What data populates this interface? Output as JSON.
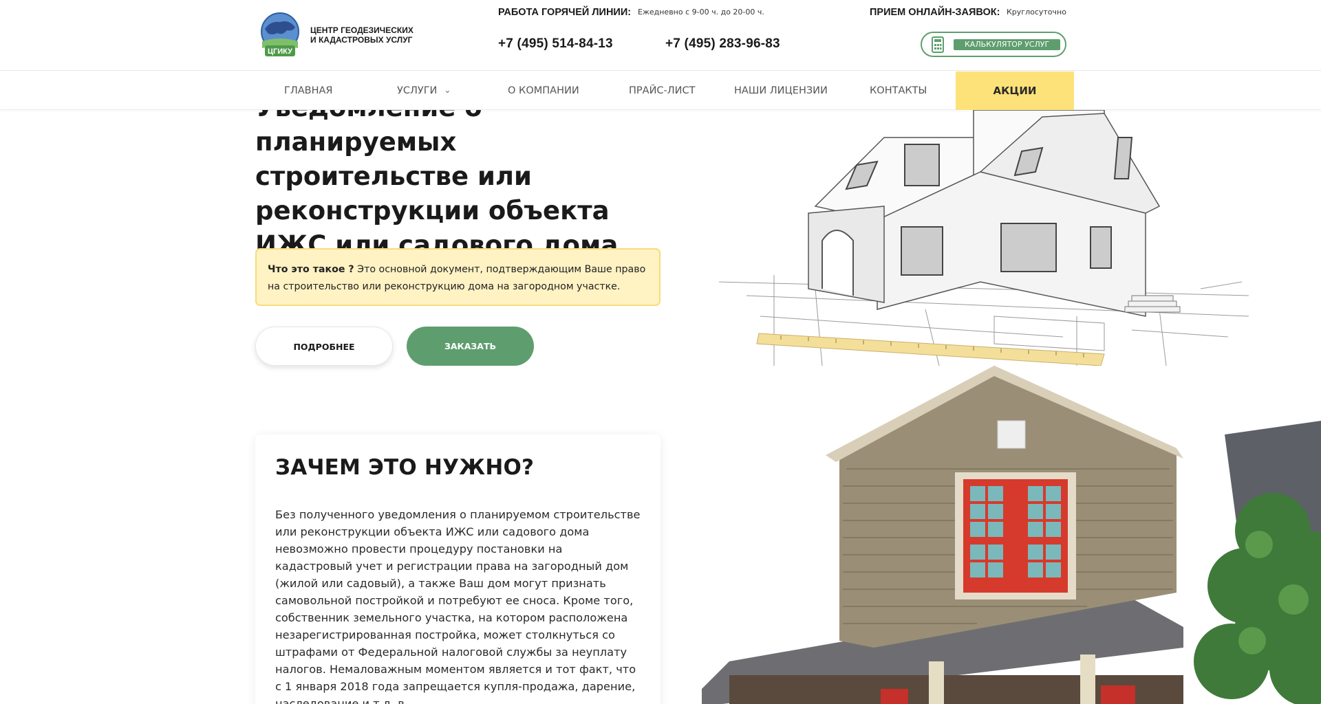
{
  "header": {
    "logo": {
      "abbr": "ЦГИКУ",
      "name": "ЦЕНТР ГЕОДЕЗИЧЕСКИХ\nИ КАДАСТРОВЫХ УСЛУГ"
    },
    "hotline": {
      "label": "РАБОТА ГОРЯЧЕЙ ЛИНИИ:",
      "hours": "Ежедневно с 9-00 ч. до 20-00 ч."
    },
    "phones": [
      "+7 (495) 514-84-13",
      "+7 (495) 283-96-83"
    ],
    "online": {
      "label": "ПРИЕМ ОНЛАЙН-ЗАЯВОК:",
      "hours": "Круглосуточно"
    },
    "calculator_label": "КАЛЬКУЛЯТОР УСЛУГ"
  },
  "nav": {
    "items": [
      "ГЛАВНАЯ",
      "УСЛУГИ",
      "О КОМПАНИИ",
      "ПРАЙС-ЛИСТ",
      "НАШИ ЛИЦЕНЗИИ",
      "КОНТАКТЫ"
    ],
    "promo": "АКЦИИ"
  },
  "hero": {
    "title": "Уведомление о планируемых строительстве или реконструкции объекта ИЖС или садового дома",
    "info_bold": "Что это такое ?",
    "info_text": " Это основной документ, подтверждающим Ваше право на строительство или реконструкцию дома на загородном участке.",
    "more_button": "ПОДРОБНЕЕ",
    "order_button": "ЗАКАЗАТЬ"
  },
  "why": {
    "title": "ЗАЧЕМ ЭТО НУЖНО?",
    "text": "Без полученного уведомления о планируемом строительстве или реконструкции объекта ИЖС или садового дома невозможно провести процедуру постановки на кадастровый учет и регистрации права на загородный дом (жилой или садовый), а также Ваш дом могут признать самовольной постройкой и потребуют ее сноса. Кроме того, собственник земельного участка, на котором расположена незарегистрированная постройка, может столкнуться со штрафами от Федеральной налоговой службы за неуплату налогов. Немаловажным моментом является и тот факт, что с 1 января 2018 года запрещается купля-продажа, дарение, наследование и т.д. в"
  },
  "colors": {
    "brand_green": "#5e9e6e",
    "promo_yellow": "#fde27a",
    "info_bg": "#fff2c3"
  }
}
